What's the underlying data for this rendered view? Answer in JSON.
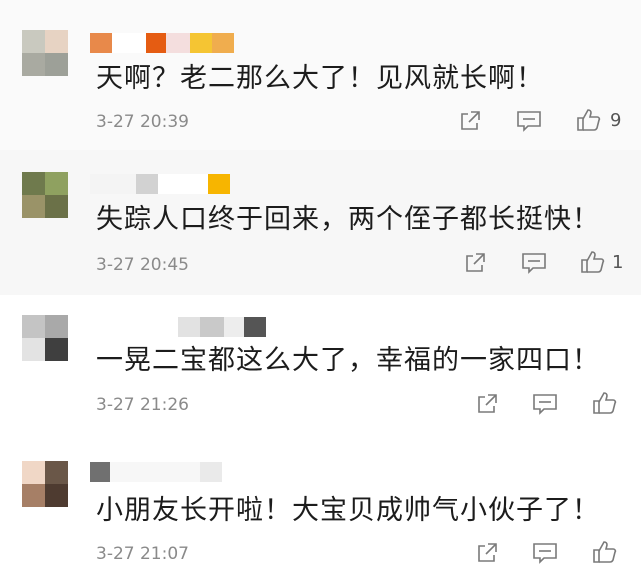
{
  "comments": [
    {
      "text": "天啊？老二那么大了！见风就长啊！",
      "time": "3-27 20:39",
      "likes": "9",
      "avatar_colors": [
        "#c9c9bf",
        "#e7d3c3",
        "#a9aaa1",
        "#9da098"
      ],
      "name_colors": [
        "#e8894a",
        "#ffffff",
        "#f3f3f3",
        "#e55c12",
        "#f4dede",
        "#f5c533",
        "#f0ad4e"
      ]
    },
    {
      "text": "失踪人口终于回来，两个侄子都长挺快！",
      "time": "3-27 20:45",
      "likes": "1",
      "avatar_colors": [
        "#6f7a4d",
        "#8fa160",
        "#9a9368",
        "#6b7148"
      ],
      "name_colors": [
        "#f4f4f4",
        "#f8f8f8",
        "#d2d2d2",
        "#ffffff",
        "#f7b500"
      ]
    },
    {
      "text": "一晃二宝都这么大了，幸福的一家四口！",
      "time": "3-27 21:26",
      "likes": "",
      "avatar_colors": [
        "#c4c4c4",
        "#a9a9a9",
        "#e3e3e3",
        "#3f3f3f"
      ],
      "name_colors": [
        "#e2e2e2",
        "#c9c9c9",
        "#ededed",
        "#555555"
      ]
    },
    {
      "text": "小朋友长开啦！大宝贝成帅气小伙子了！",
      "time": "3-27 21:07",
      "likes": "",
      "avatar_colors": [
        "#f0d7c6",
        "#6a5748",
        "#a67f66",
        "#4e3b30"
      ],
      "name_colors": [
        "#707070",
        "#f7f7f7",
        "#eaeaea"
      ]
    }
  ],
  "icons": {
    "share": "share-icon",
    "comment": "comment-icon",
    "like": "thumbs-up-icon"
  }
}
